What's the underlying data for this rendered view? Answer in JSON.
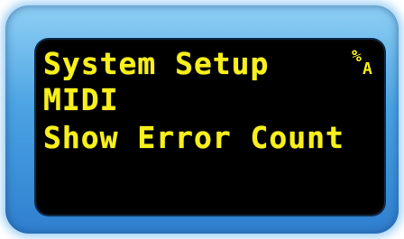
{
  "display": {
    "menu_title": "System Setup",
    "menu_item": "MIDI",
    "menu_option": "Show Error Count",
    "mode_indicator": {
      "icon": "percent-a-mode-icon",
      "top_glyph": "%",
      "bottom_glyph": "A"
    }
  },
  "colors": {
    "text": "#f7f01a",
    "screen": "#000000",
    "bezel": "#4aa3e3"
  }
}
